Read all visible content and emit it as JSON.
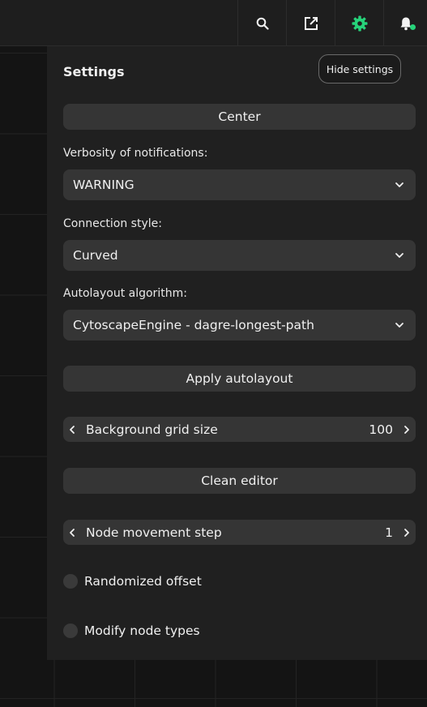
{
  "toolbar": {
    "icons": [
      "search-icon",
      "export-icon",
      "gear-icon",
      "bell-icon"
    ],
    "accent": "#27d27a"
  },
  "settings": {
    "title": "Settings",
    "hide_label": "Hide settings",
    "center_label": "Center",
    "verbosity": {
      "label": "Verbosity of notifications:",
      "value": "WARNING"
    },
    "connection_style": {
      "label": "Connection style:",
      "value": "Curved"
    },
    "autolayout": {
      "label": "Autolayout algorithm:",
      "value": "CytoscapeEngine - dagre-longest-path"
    },
    "apply_label": "Apply autolayout",
    "grid_size": {
      "label": "Background grid size",
      "value": "100"
    },
    "clean_label": "Clean editor",
    "movement_step": {
      "label": "Node movement step",
      "value": "1"
    },
    "randomized_offset": {
      "label": "Randomized offset",
      "checked": false
    },
    "modify_node_types": {
      "label": "Modify node types",
      "checked": false
    }
  }
}
